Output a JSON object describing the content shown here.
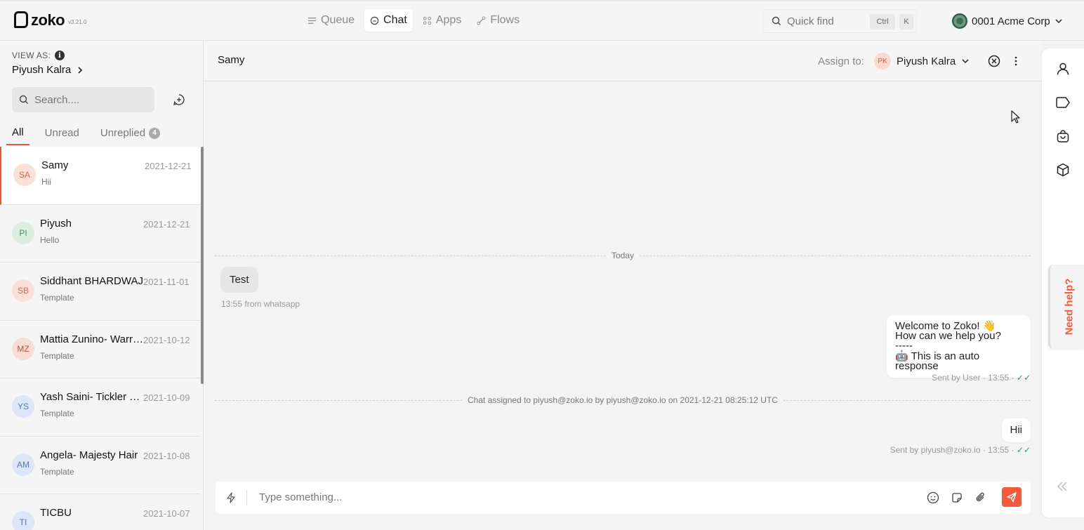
{
  "app": {
    "logo_text": "zoko",
    "version": "v3.21.0"
  },
  "nav": {
    "items": [
      {
        "label": "Queue",
        "icon": "queue-icon"
      },
      {
        "label": "Chat",
        "icon": "chat-icon",
        "active": true
      },
      {
        "label": "Apps",
        "icon": "apps-icon"
      },
      {
        "label": "Flows",
        "icon": "flows-icon"
      }
    ]
  },
  "quickfind": {
    "label": "Quick find",
    "key1": "Ctrl",
    "key2": "K"
  },
  "org": {
    "name": "0001 Acme Corp"
  },
  "sidebar": {
    "view_as_label": "VIEW AS:",
    "view_as_user": "Piyush Kalra",
    "search_placeholder": "Search....",
    "tabs": [
      {
        "label": "All",
        "active": true
      },
      {
        "label": "Unread"
      },
      {
        "label": "Unreplied",
        "badge": "4"
      }
    ],
    "conversations": [
      {
        "initials": "SA",
        "name": "Samy",
        "date": "2021-12-21",
        "preview": "Hii",
        "avatar_bg": "#fbe0d8",
        "avatar_fg": "#d8684c",
        "active": true
      },
      {
        "initials": "PI",
        "name": "Piyush",
        "date": "2021-12-21",
        "preview": "Hello",
        "avatar_bg": "#dbeee2",
        "avatar_fg": "#4a8a64"
      },
      {
        "initials": "SB",
        "name": "Siddhant BHARDWAJ",
        "date": "2021-11-01",
        "preview": "Template",
        "avatar_bg": "#fbe0d8",
        "avatar_fg": "#d8684c"
      },
      {
        "initials": "MZ",
        "name": "Mattia Zunino- Warriors",
        "date": "2021-10-12",
        "preview": "Template",
        "avatar_bg": "#f7ddd6",
        "avatar_fg": "#b2553e"
      },
      {
        "initials": "YS",
        "name": "Yash Saini- Tickler Shop",
        "date": "2021-10-09",
        "preview": "Template",
        "avatar_bg": "#dde6f8",
        "avatar_fg": "#5576b8"
      },
      {
        "initials": "AM",
        "name": "Angela- Majesty Hair",
        "date": "2021-10-08",
        "preview": "Template",
        "avatar_bg": "#dde6f8",
        "avatar_fg": "#5576b8"
      },
      {
        "initials": "TI",
        "name": "TICBU",
        "date": "2021-10-07",
        "preview": "",
        "avatar_bg": "#dde6f8",
        "avatar_fg": "#5576b8"
      }
    ]
  },
  "chat": {
    "title": "Samy",
    "assign_label": "Assign to:",
    "assignee_initials": "PK",
    "assignee_name": "Piyush Kalra",
    "today_label": "Today",
    "msg_in_text": "Test",
    "msg_in_meta": "13:55 from whatsapp",
    "auto_line1": "Welcome to Zoko! 👋",
    "auto_line2": "How can we help you?",
    "auto_line3": "-----",
    "auto_line4": "🤖 This is an auto response",
    "auto_meta": "Sent by User · 13:55 ·",
    "assigned_event": "Chat assigned to piyush@zoko.io by piyush@zoko.io on 2021-12-21 08:25:12 UTC",
    "msg_out_text": "Hii",
    "msg_out_meta": "Sent by piyush@zoko.io · 13:55 ·",
    "checks": "✓✓"
  },
  "composer": {
    "placeholder": "Type something..."
  },
  "help": {
    "label": "Need help?"
  },
  "colors": {
    "accent": "#f25a3a",
    "active_border": "#e05a3a"
  }
}
